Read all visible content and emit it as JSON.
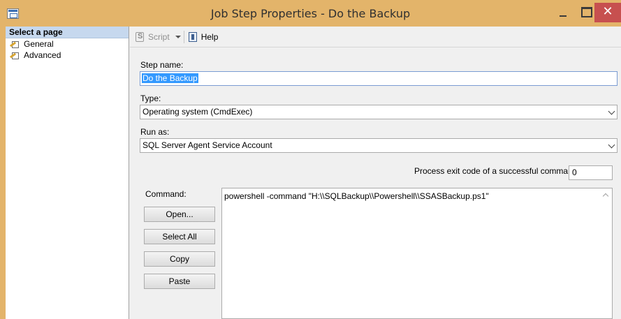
{
  "window": {
    "title": "Job Step Properties - Do the Backup",
    "close_glyph": "✕"
  },
  "sidebar": {
    "header": "Select a page",
    "items": [
      {
        "label": "General",
        "icon": "page-properties-icon"
      },
      {
        "label": "Advanced",
        "icon": "page-properties-icon"
      }
    ]
  },
  "toolbar": {
    "script_label": "Script",
    "help_label": "Help"
  },
  "form": {
    "step_name_label": "Step name:",
    "step_name_value": "Do the Backup",
    "type_label": "Type:",
    "type_value": "Operating system (CmdExec)",
    "run_as_label": "Run as:",
    "run_as_value": "SQL Server Agent Service Account",
    "exit_code_label": "Process exit code of a successful command:",
    "exit_code_value": "0",
    "command_label": "Command:",
    "command_value": "powershell -command \"H:\\\\SQLBackup\\\\Powershell\\\\SSASBackup.ps1\""
  },
  "buttons": {
    "open": "Open...",
    "select_all": "Select All",
    "copy": "Copy",
    "paste": "Paste"
  },
  "colors": {
    "titlebar": "#e3b46a",
    "close_button": "#c7504f",
    "selection": "#3399ff",
    "sidebar_header": "#c6d8ee"
  }
}
